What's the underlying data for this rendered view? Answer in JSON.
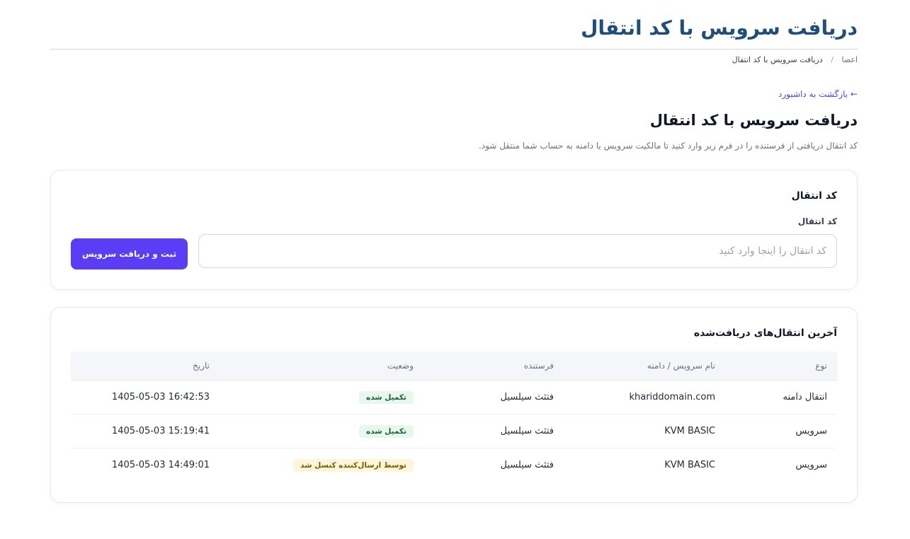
{
  "page": {
    "title": "دریافت سرویس با کد انتقال"
  },
  "breadcrumb": {
    "items": [
      "اعضا",
      "دریافت سرویس با کد انتقال"
    ],
    "separator": "/"
  },
  "back_link": "← بازگشت به داشبورد",
  "section": {
    "title": "دریافت سرویس با کد انتقال",
    "description": "کد انتقال دریافتی از فرستنده را در فرم زیر وارد کنید تا مالکیت سرویس یا دامنه به حساب شما منتقل شود."
  },
  "form": {
    "heading": "کد انتقال",
    "field_label": "کد انتقال",
    "input_value": "",
    "input_placeholder": "کد انتقال را اینجا وارد کنید",
    "submit_label": "ثبت و دریافت سرویس"
  },
  "transfers": {
    "heading": "آخرین انتقال‌های دریافت‌شده",
    "columns": [
      "نوع",
      "نام سرویس / دامنه",
      "فرستنده",
      "وضعیت",
      "تاریخ"
    ],
    "rows": [
      {
        "type": "انتقال دامنه",
        "service": "khariddomain.com",
        "sender": "فتثث سیلسیل",
        "status": "تکمیل شده",
        "status_kind": "success",
        "date": "1405-05-03 16:42:53"
      },
      {
        "type": "سرویس",
        "service": "KVM BASIC",
        "sender": "فتثث سیلسیل",
        "status": "تکمیل شده",
        "status_kind": "success",
        "date": "1405-05-03 15:19:41"
      },
      {
        "type": "سرویس",
        "service": "KVM BASIC",
        "sender": "فتثث سیلسیل",
        "status": "توسط ارسال‌کننده کنسل شد",
        "status_kind": "warning",
        "date": "1405-05-03 14:49:01"
      }
    ]
  },
  "colors": {
    "title": "#1e4e79",
    "accent": "#5b3df5",
    "link": "#4f46e5",
    "success_bg": "#e8f8ee",
    "warning_bg": "#fff6d9"
  }
}
